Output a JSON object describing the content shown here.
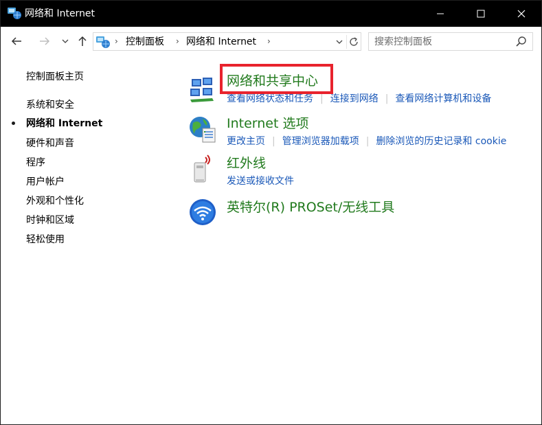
{
  "window": {
    "title": "网络和 Internet",
    "minimize_glyph": "—",
    "maximize_glyph": "☐",
    "close_glyph": "✕"
  },
  "toolbar": {
    "back_glyph": "←",
    "forward_glyph": "→",
    "recent_glyph": "⌄",
    "up_glyph": "↑"
  },
  "address": {
    "breadcrumbs": [
      "控制面板",
      "网络和 Internet"
    ],
    "separator": "›"
  },
  "search": {
    "placeholder": "搜索控制面板",
    "value": ""
  },
  "sidebar": {
    "home": "控制面板主页",
    "items": [
      {
        "label": "系统和安全",
        "active": false
      },
      {
        "label": "网络和 Internet",
        "active": true
      },
      {
        "label": "硬件和声音",
        "active": false
      },
      {
        "label": "程序",
        "active": false
      },
      {
        "label": "用户帐户",
        "active": false
      },
      {
        "label": "外观和个性化",
        "active": false
      },
      {
        "label": "时钟和区域",
        "active": false
      },
      {
        "label": "轻松使用",
        "active": false
      }
    ]
  },
  "categories": [
    {
      "title": "网络和共享中心",
      "icon": "network-sharing-center-icon",
      "links": [
        "查看网络状态和任务",
        "连接到网络",
        "查看网络计算机和设备"
      ]
    },
    {
      "title": "Internet 选项",
      "icon": "internet-options-icon",
      "links": [
        "更改主页",
        "管理浏览器加载项",
        "删除浏览的历史记录和 cookie"
      ]
    },
    {
      "title": "红外线",
      "icon": "infrared-icon",
      "links": [
        "发送或接收文件"
      ]
    },
    {
      "title": "英特尔(R) PROSet/无线工具",
      "icon": "intel-wireless-icon",
      "links": []
    }
  ],
  "colors": {
    "category_title": "#217a1d",
    "link": "#1a58b8",
    "highlight": "#e8232d",
    "titlebar": "#000000"
  }
}
